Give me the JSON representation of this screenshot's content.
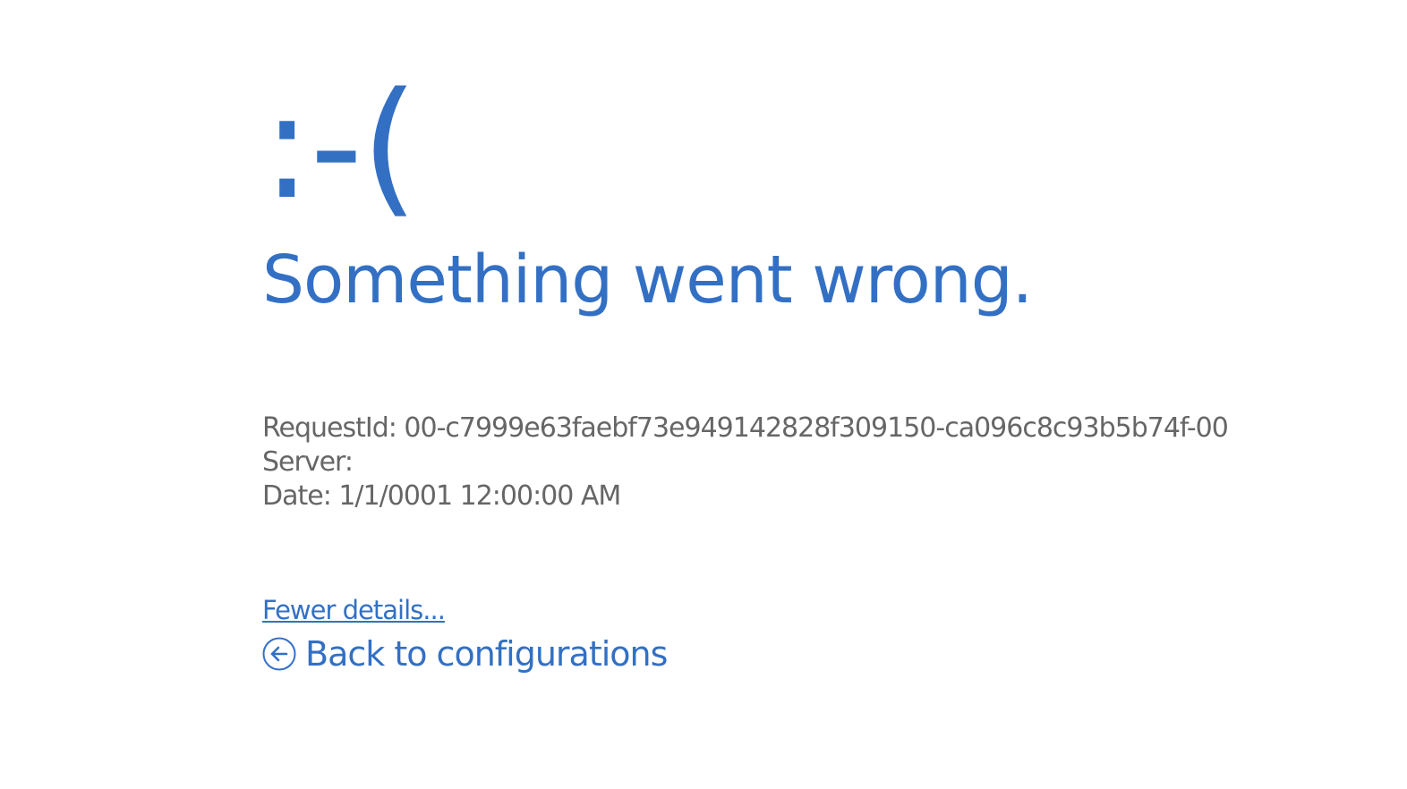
{
  "error": {
    "face": ":-(",
    "headline": "Something went wrong."
  },
  "details": {
    "request_id_line": "RequestId: 00-c7999e63faebf73e949142828f309150-ca096c8c93b5b74f-00",
    "server_line": "Server:",
    "date_line": "Date: 1/1/0001 12:00:00 AM"
  },
  "links": {
    "fewer_details": "Fewer details...",
    "back_to_configurations": "Back to configurations",
    "back_icon": "circle-arrow-left-icon"
  },
  "colors": {
    "accent": "#3370c4",
    "detail_text": "#666666",
    "background": "#ffffff"
  }
}
